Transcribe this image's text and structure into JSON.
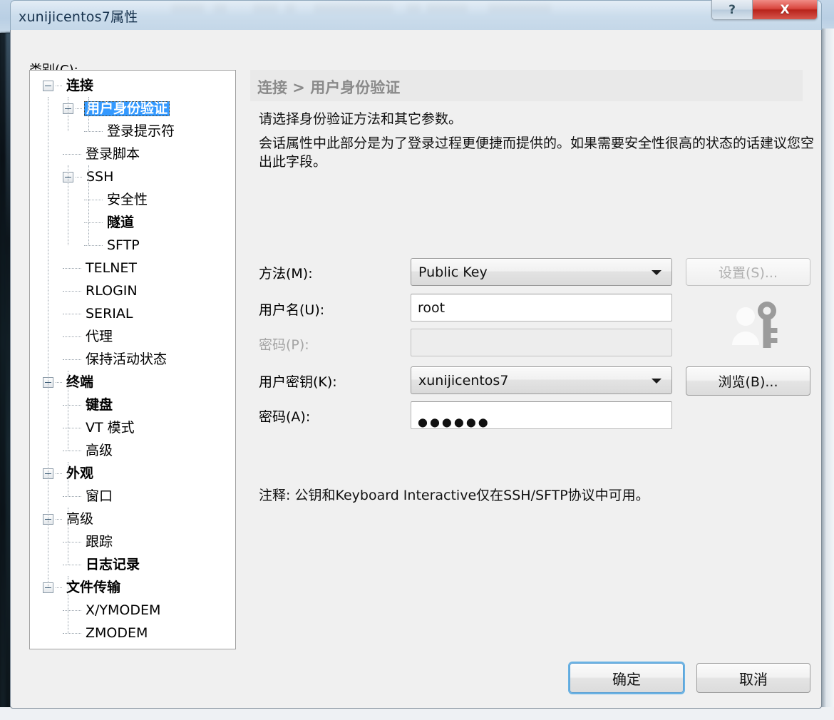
{
  "window": {
    "title": "xunijicentos7属性",
    "help_label": "?",
    "close_label": "X"
  },
  "category": {
    "label": "类别(C):"
  },
  "tree": {
    "selected": "用户身份验证",
    "items": [
      {
        "label": "连接",
        "depth": 0,
        "bold": true,
        "expander": true,
        "selected": false
      },
      {
        "label": "用户身份验证",
        "depth": 1,
        "bold": true,
        "expander": true,
        "selected": true
      },
      {
        "label": "登录提示符",
        "depth": 2,
        "bold": false,
        "expander": false,
        "selected": false
      },
      {
        "label": "登录脚本",
        "depth": 1,
        "bold": false,
        "expander": false,
        "selected": false
      },
      {
        "label": "SSH",
        "depth": 1,
        "bold": false,
        "expander": true,
        "selected": false
      },
      {
        "label": "安全性",
        "depth": 2,
        "bold": false,
        "expander": false,
        "selected": false
      },
      {
        "label": "隧道",
        "depth": 2,
        "bold": true,
        "expander": false,
        "selected": false
      },
      {
        "label": "SFTP",
        "depth": 2,
        "bold": false,
        "expander": false,
        "selected": false
      },
      {
        "label": "TELNET",
        "depth": 1,
        "bold": false,
        "expander": false,
        "selected": false
      },
      {
        "label": "RLOGIN",
        "depth": 1,
        "bold": false,
        "expander": false,
        "selected": false
      },
      {
        "label": "SERIAL",
        "depth": 1,
        "bold": false,
        "expander": false,
        "selected": false
      },
      {
        "label": "代理",
        "depth": 1,
        "bold": false,
        "expander": false,
        "selected": false
      },
      {
        "label": "保持活动状态",
        "depth": 1,
        "bold": false,
        "expander": false,
        "selected": false
      },
      {
        "label": "终端",
        "depth": 0,
        "bold": true,
        "expander": true,
        "selected": false
      },
      {
        "label": "键盘",
        "depth": 1,
        "bold": true,
        "expander": false,
        "selected": false
      },
      {
        "label": "VT 模式",
        "depth": 1,
        "bold": false,
        "expander": false,
        "selected": false
      },
      {
        "label": "高级",
        "depth": 1,
        "bold": false,
        "expander": false,
        "selected": false
      },
      {
        "label": "外观",
        "depth": 0,
        "bold": true,
        "expander": true,
        "selected": false
      },
      {
        "label": "窗口",
        "depth": 1,
        "bold": false,
        "expander": false,
        "selected": false
      },
      {
        "label": "高级",
        "depth": 0,
        "bold": false,
        "expander": true,
        "selected": false
      },
      {
        "label": "跟踪",
        "depth": 1,
        "bold": false,
        "expander": false,
        "selected": false
      },
      {
        "label": "日志记录",
        "depth": 1,
        "bold": true,
        "expander": false,
        "selected": false
      },
      {
        "label": "文件传输",
        "depth": 0,
        "bold": true,
        "expander": true,
        "selected": false
      },
      {
        "label": "X/YMODEM",
        "depth": 1,
        "bold": false,
        "expander": false,
        "selected": false
      },
      {
        "label": "ZMODEM",
        "depth": 1,
        "bold": false,
        "expander": false,
        "selected": false
      }
    ]
  },
  "content": {
    "breadcrumb": "连接 > 用户身份验证",
    "description_line1": "请选择身份验证方法和其它参数。",
    "description_line2": "会话属性中此部分是为了登录过程更便捷而提供的。如果需要安全性很高的状态的话建议您空出此字段。",
    "note": "注释: 公钥和Keyboard Interactive仅在SSH/SFTP协议中可用。",
    "form": {
      "method_label": "方法(M):",
      "method_value": "Public Key",
      "settings_button": "设置(S)...",
      "username_label": "用户名(U):",
      "username_value": "root",
      "password_label": "密码(P):",
      "password_value": "",
      "userkey_label": "用户密钥(K):",
      "userkey_value": "xunijicentos7",
      "browse_button": "浏览(B)...",
      "passphrase_label": "密码(A):",
      "passphrase_value": "●●●●●●"
    }
  },
  "footer": {
    "ok_label": "确定",
    "cancel_label": "取消"
  },
  "colors": {
    "selection_blue": "#3399ff",
    "breadcrumb_gray": "#8a8a8a",
    "close_red": "#b8231b",
    "default_button_glow": "#52a8e2",
    "dialog_bg": "#f0f0f0"
  }
}
